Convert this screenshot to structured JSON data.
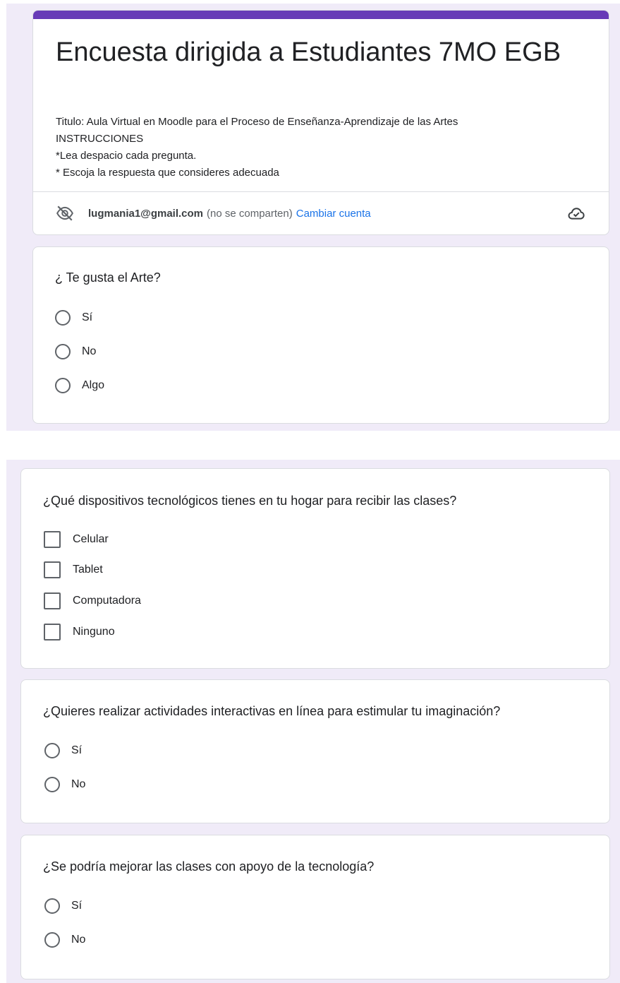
{
  "form": {
    "title": "Encuesta dirigida a Estudiantes 7MO EGB",
    "description": [
      "Titulo: Aula Virtual en Moodle para el Proceso de Enseñanza-Aprendizaje de las Artes",
      "INSTRUCCIONES",
      "*Lea despacio cada pregunta.",
      "* Escoja la respuesta que consideres adecuada"
    ],
    "accent_color": "#673ab7",
    "background_color": "#f0ebf8",
    "link_color": "#1a73e8"
  },
  "account": {
    "email": "lugmania1@gmail.com",
    "note": "(no se comparten)",
    "switch_label": "Cambiar cuenta",
    "privacy_icon": "eye-off-icon",
    "status_icon": "cloud-done-icon"
  },
  "questions": [
    {
      "title": "¿ Te gusta el Arte?",
      "type": "radio",
      "options": [
        "Sí",
        "No",
        "Algo"
      ]
    },
    {
      "title": "¿Qué dispositivos tecnológicos tienes en tu hogar para recibir las clases?",
      "type": "checkbox",
      "options": [
        "Celular",
        "Tablet",
        "Computadora",
        "Ninguno"
      ]
    },
    {
      "title": "¿Quieres realizar actividades interactivas en línea para estimular tu imaginación?",
      "type": "radio",
      "options": [
        "Sí",
        "No"
      ]
    },
    {
      "title": "¿Se podría mejorar las clases con apoyo de la tecnología?",
      "type": "radio",
      "options": [
        "Sí",
        "No"
      ]
    }
  ]
}
